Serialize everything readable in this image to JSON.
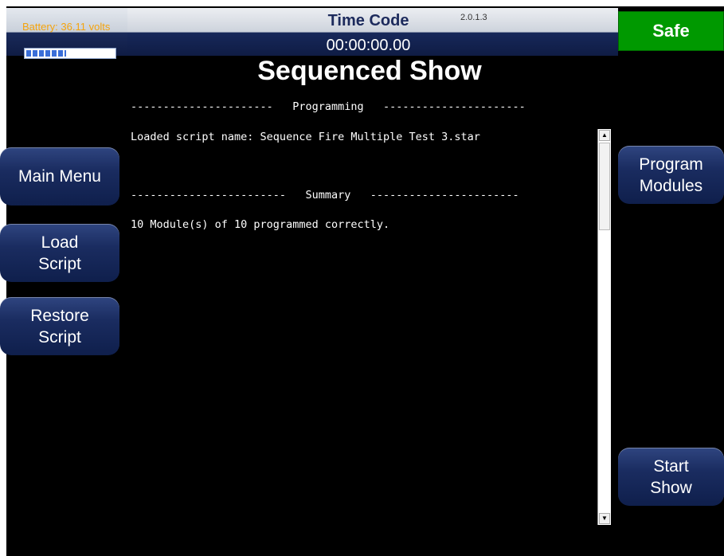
{
  "battery": {
    "label": "Battery: 36.11 volts",
    "level_fraction": 0.45
  },
  "time_code": {
    "label": "Time Code",
    "value": "00:00:00.00"
  },
  "version": "2.0.1.3",
  "status_button": {
    "label": "Safe",
    "color": "#009900"
  },
  "page_title": "Sequenced Show",
  "log": {
    "programming_header": "----------------------   Programming   ----------------------",
    "loaded_script": "Loaded script name: Sequence Fire Multiple Test 3.star",
    "summary_header": "------------------------   Summary   -----------------------",
    "summary_result": "10 Module(s) of 10 programmed correctly."
  },
  "left_buttons": {
    "main_menu": "Main Menu",
    "load_script_line1": "Load",
    "load_script_line2": "Script",
    "restore_script_line1": "Restore",
    "restore_script_line2": "Script"
  },
  "right_buttons": {
    "program_modules_line1": "Program",
    "program_modules_line2": "Modules",
    "start_show_line1": "Start",
    "start_show_line2": "Show"
  },
  "colors": {
    "background": "#000000",
    "button": "#1a2c60",
    "battery_text": "#f4a40e"
  }
}
